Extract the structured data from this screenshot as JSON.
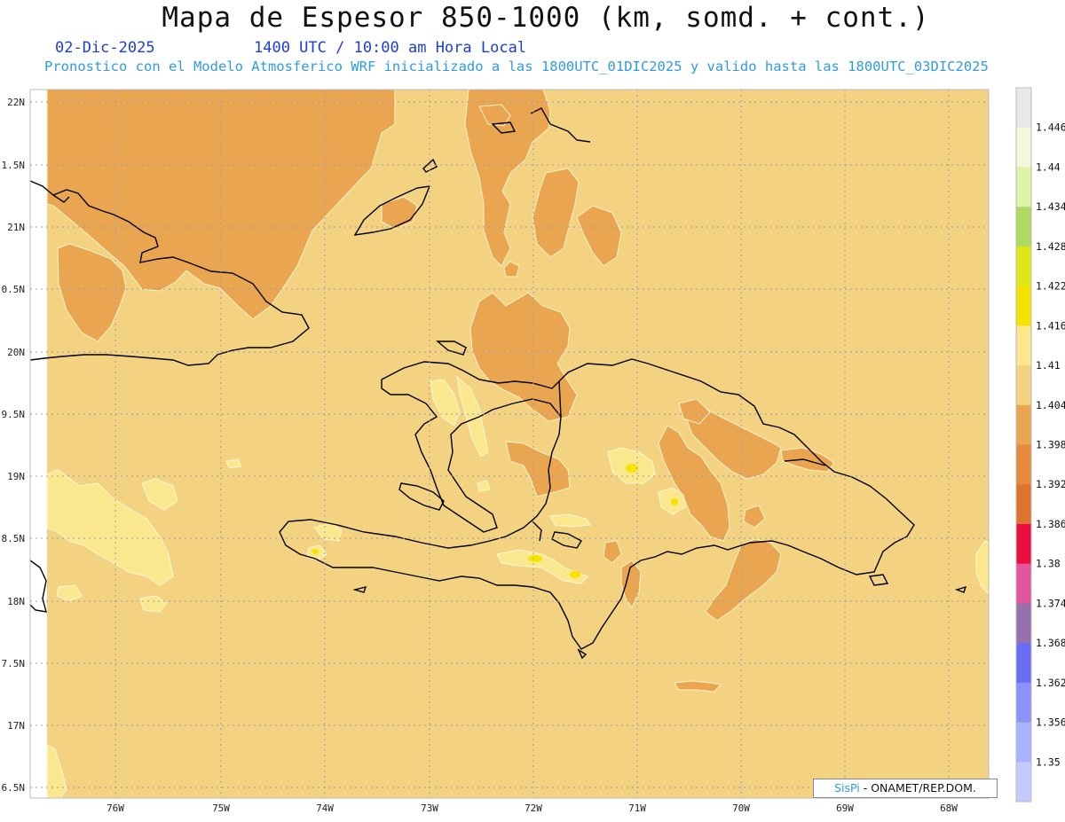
{
  "title": "Mapa de Espesor 850-1000 (km, somd. + cont.)",
  "date_text": "02-Dic-2025",
  "time_text": "1400 UTC / 10:00 am Hora Local",
  "forecast_text": "Pronostico con el Modelo Atmosferico WRF inicializado a las 1800UTC_01DIC2025 y valido hasta las  1800UTC_03DIC2025",
  "credit": {
    "brand": "SisPi",
    "org": " - ONAMET/REP.DOM."
  },
  "lat_labels": [
    "22N",
    "1.5N",
    "21N",
    "0.5N",
    "20N",
    "9.5N",
    "19N",
    "8.5N",
    "18N",
    "7.5N",
    "17N",
    "6.5N"
  ],
  "lon_labels": [
    "76W",
    "75W",
    "74W",
    "73W",
    "72W",
    "71W",
    "70W",
    "69W",
    "68W"
  ],
  "legend": {
    "levels": [
      "1.446",
      "1.44",
      "1.434",
      "1.428",
      "1.422",
      "1.416",
      "1.41",
      "1.404",
      "1.398",
      "1.392",
      "1.386",
      "1.38",
      "1.374",
      "1.368",
      "1.362",
      "1.356",
      "1.35"
    ],
    "colors": [
      "#e8e8e8",
      "#f4f7d9",
      "#dff3a6",
      "#aeda62",
      "#dde71a",
      "#f6e400",
      "#fbe88e",
      "#f3d282",
      "#eaa550",
      "#e58c3c",
      "#dc7430",
      "#ec0e40",
      "#e2569f",
      "#9a6fad",
      "#6a6cf6",
      "#8b92f9",
      "#a8b3fb",
      "#c2cbfb"
    ]
  },
  "colors": {
    "background": "#f3d282",
    "warm": "#eaa550",
    "light": "#fbe88e",
    "yellow": "#f6e400",
    "coast": "#000000"
  }
}
